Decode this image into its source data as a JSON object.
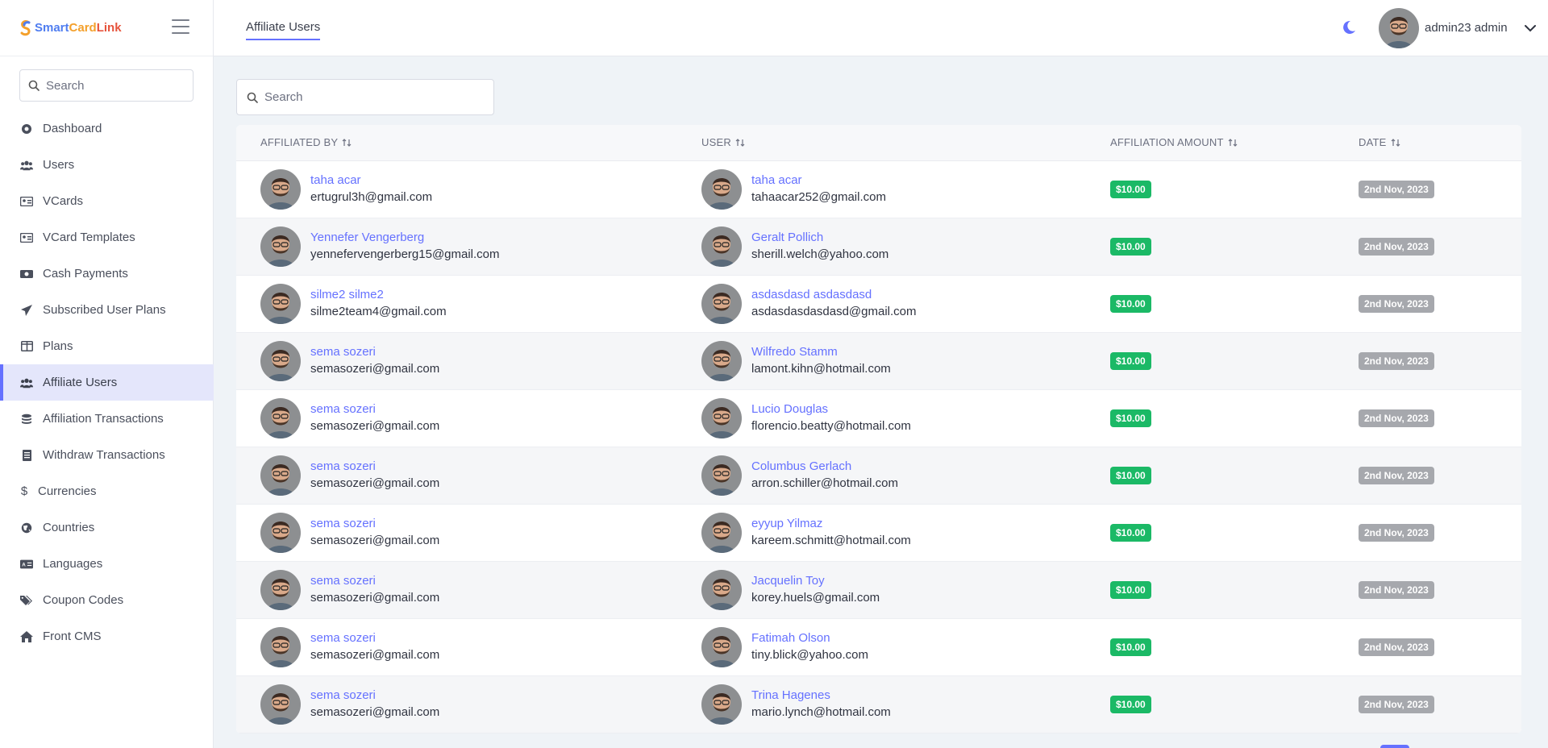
{
  "brand": {
    "smart": "Smart",
    "card": "Card",
    "link": "Link"
  },
  "sidebar": {
    "search_placeholder": "Search",
    "items": [
      {
        "label": "Dashboard",
        "icon": "dashboard-icon"
      },
      {
        "label": "Users",
        "icon": "users-icon"
      },
      {
        "label": "VCards",
        "icon": "vcard-icon"
      },
      {
        "label": "VCard Templates",
        "icon": "vcard-template-icon"
      },
      {
        "label": "Cash Payments",
        "icon": "cash-icon"
      },
      {
        "label": "Subscribed User Plans",
        "icon": "paper-plane-icon"
      },
      {
        "label": "Plans",
        "icon": "plans-icon"
      },
      {
        "label": "Affiliate Users",
        "icon": "users-icon",
        "active": true
      },
      {
        "label": "Affiliation Transactions",
        "icon": "coins-icon"
      },
      {
        "label": "Withdraw Transactions",
        "icon": "receipt-icon"
      },
      {
        "label": "Currencies",
        "icon": "dollar-icon"
      },
      {
        "label": "Countries",
        "icon": "globe-icon"
      },
      {
        "label": "Languages",
        "icon": "language-icon"
      },
      {
        "label": "Coupon Codes",
        "icon": "tags-icon"
      },
      {
        "label": "Front CMS",
        "icon": "home-icon"
      }
    ]
  },
  "header": {
    "tab": "Affiliate Users",
    "user_name": "admin23 admin"
  },
  "main": {
    "search_placeholder": "Search"
  },
  "table": {
    "columns": [
      "AFFILIATED BY",
      "USER",
      "AFFILIATION AMOUNT",
      "DATE"
    ],
    "rows": [
      {
        "by_name": "taha acar",
        "by_email": "ertugrul3h@gmail.com",
        "user_name": "taha acar",
        "user_email": "tahaacar252@gmail.com",
        "amount": "$10.00",
        "date": "2nd Nov, 2023"
      },
      {
        "by_name": "Yennefer Vengerberg",
        "by_email": "yennefervengerberg15@gmail.com",
        "user_name": "Geralt Pollich",
        "user_email": "sherill.welch@yahoo.com",
        "amount": "$10.00",
        "date": "2nd Nov, 2023"
      },
      {
        "by_name": "silme2 silme2",
        "by_email": "silme2team4@gmail.com",
        "user_name": "asdasdasd asdasdasd",
        "user_email": "asdasdasdasdasd@gmail.com",
        "amount": "$10.00",
        "date": "2nd Nov, 2023"
      },
      {
        "by_name": "sema sozeri",
        "by_email": "semasozeri@gmail.com",
        "user_name": "Wilfredo Stamm",
        "user_email": "lamont.kihn@hotmail.com",
        "amount": "$10.00",
        "date": "2nd Nov, 2023"
      },
      {
        "by_name": "sema sozeri",
        "by_email": "semasozeri@gmail.com",
        "user_name": "Lucio Douglas",
        "user_email": "florencio.beatty@hotmail.com",
        "amount": "$10.00",
        "date": "2nd Nov, 2023"
      },
      {
        "by_name": "sema sozeri",
        "by_email": "semasozeri@gmail.com",
        "user_name": "Columbus Gerlach",
        "user_email": "arron.schiller@hotmail.com",
        "amount": "$10.00",
        "date": "2nd Nov, 2023"
      },
      {
        "by_name": "sema sozeri",
        "by_email": "semasozeri@gmail.com",
        "user_name": "eyyup Yilmaz",
        "user_email": "kareem.schmitt@hotmail.com",
        "amount": "$10.00",
        "date": "2nd Nov, 2023"
      },
      {
        "by_name": "sema sozeri",
        "by_email": "semasozeri@gmail.com",
        "user_name": "Jacquelin Toy",
        "user_email": "korey.huels@gmail.com",
        "amount": "$10.00",
        "date": "2nd Nov, 2023"
      },
      {
        "by_name": "sema sozeri",
        "by_email": "semasozeri@gmail.com",
        "user_name": "Fatimah Olson",
        "user_email": "tiny.blick@yahoo.com",
        "amount": "$10.00",
        "date": "2nd Nov, 2023"
      },
      {
        "by_name": "sema sozeri",
        "by_email": "semasozeri@gmail.com",
        "user_name": "Trina Hagenes",
        "user_email": "mario.lynch@hotmail.com",
        "amount": "$10.00",
        "date": "2nd Nov, 2023"
      }
    ]
  },
  "colors": {
    "accent": "#6571ff",
    "success": "#1bb966",
    "muted_badge": "#a6a8ad"
  }
}
